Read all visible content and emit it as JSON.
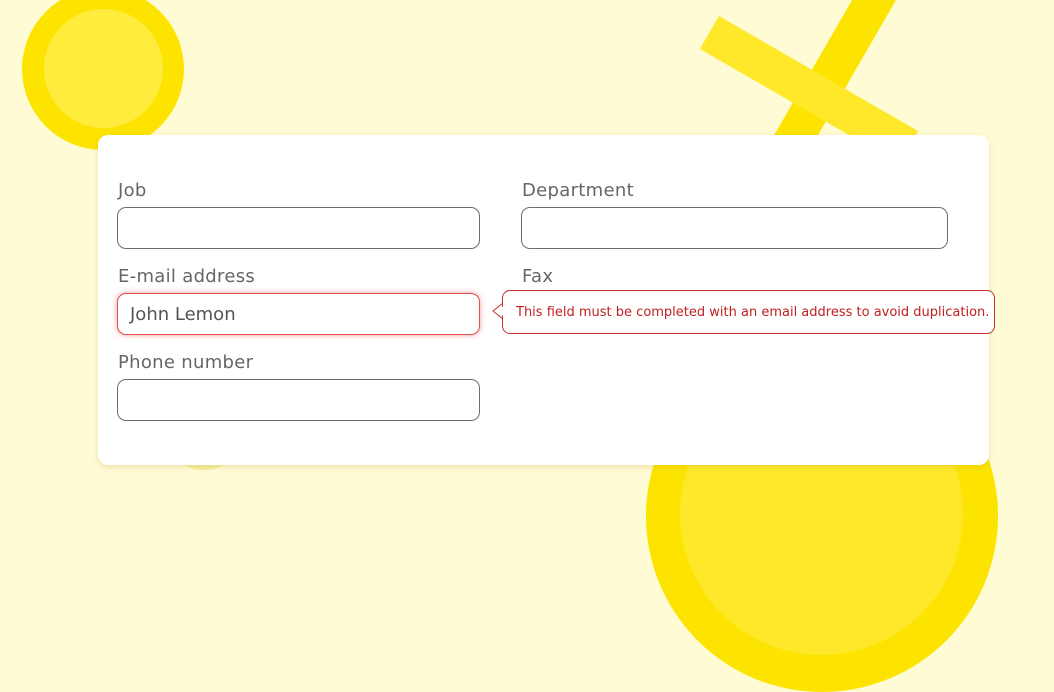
{
  "form": {
    "job": {
      "label": "Job",
      "value": ""
    },
    "department": {
      "label": "Department",
      "value": ""
    },
    "email": {
      "label": "E-mail address",
      "value": "John Lemon"
    },
    "fax": {
      "label": "Fax"
    },
    "phone": {
      "label": "Phone number",
      "value": ""
    }
  },
  "error_tooltip": {
    "message": "This field must be completed with an email address to avoid duplication."
  },
  "colors": {
    "background": "#fffbd5",
    "accent_yellow": "#fde400",
    "error_red": "#c02020"
  }
}
